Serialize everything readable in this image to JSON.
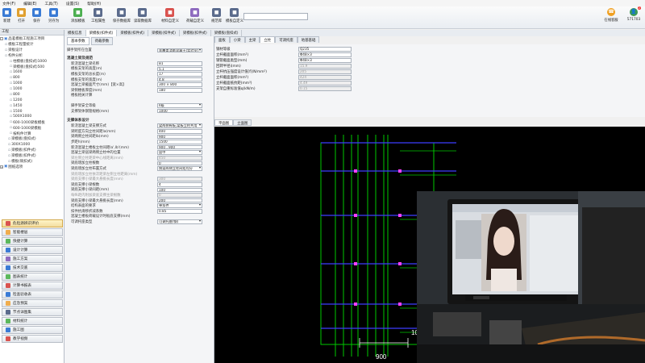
{
  "menu": [
    "文件(F)",
    "编辑(E)",
    "工具(T)",
    "设置(S)",
    "帮助(H)"
  ],
  "toolbar": [
    {
      "label": "新建",
      "icon": "new-file-icon",
      "color": "#3a7bd5"
    },
    {
      "label": "打开",
      "icon": "open-folder-icon",
      "color": "#e0a030"
    },
    {
      "label": "保存",
      "icon": "save-icon",
      "color": "#3a7bd5"
    },
    {
      "label": "另存为",
      "icon": "save-as-icon",
      "color": "#3a7bd5"
    },
    {
      "label": "添加模板",
      "icon": "add-template-icon",
      "color": "#4caf50"
    },
    {
      "label": "工程属性",
      "icon": "project-properties-icon",
      "color": "#5b6b8c"
    },
    {
      "label": "保存数据库",
      "icon": "save-db-icon",
      "color": "#5b6b8c"
    },
    {
      "label": "读取数据库",
      "icon": "read-db-icon",
      "color": "#5b6b8c"
    },
    {
      "label": "材料自定义",
      "icon": "material-custom-icon",
      "color": "#d9534f"
    },
    {
      "label": "荷载自定义",
      "icon": "load-custom-icon",
      "color": "#8e6bbf"
    },
    {
      "label": "规范库",
      "icon": "code-library-icon",
      "color": "#5b6b8c"
    },
    {
      "label": "模板自定义",
      "icon": "template-custom-icon",
      "color": "#5b6b8c"
    }
  ],
  "search": {
    "placeholder": ""
  },
  "user": {
    "label1": "在线客服",
    "label2": "571703",
    "badge": "2"
  },
  "tree": {
    "header": "工程",
    "root": "品茗模板工程施工项目",
    "items": [
      "模板工程量统计",
      "梁板设计",
      "构件分析",
      "柱模板(盘扣式)1000",
      "梁模板(盘扣式)500",
      "1600",
      "800",
      "1000",
      "1000",
      "800",
      "1200",
      "1450",
      "1500",
      "500X1000",
      "600-1000梁板模板",
      "600-1000梁模板",
      "按构件计算",
      "梁模板(盘扣式)",
      "300X1000",
      "梁模板(扣件式)",
      "梁模板(扣件式)",
      "模板(碗扣式)"
    ],
    "footer": "图纸选项"
  },
  "modules": [
    "危险源辨识评价",
    "智能楼层",
    "快捷计算",
    "设计计算",
    "施工方案",
    "技术交底",
    "图表统计",
    "计算书报表",
    "检查验收表",
    "应急预案",
    "节点详图集",
    "材料统计",
    "施工图",
    "教学视频"
  ],
  "topTabs": [
    "模板信息",
    "梁模板(扣件式)",
    "梁模板(扣件式)",
    "梁模板(扣件式)",
    "梁模板(扣件式)",
    "梁模板(盘扣式)"
  ],
  "subTabs": [
    "基本参数",
    "荷载参数"
  ],
  "form": {
    "s0_label": "脚手架所在位置",
    "s0_value": "非覆盖浇筑混凝土(实验室)",
    "s1": "混凝土梁及规范",
    "s1_rows": [
      {
        "l": "新浇混凝土梁名称",
        "v": "B1"
      },
      {
        "l": "模板支架的高度(m)",
        "v": "5.1"
      },
      {
        "l": "模板支架的总长度(m)",
        "v": "17"
      },
      {
        "l": "模板支架的宽度(m)",
        "v": "4.8"
      },
      {
        "l": "混凝土梁截面尺寸(mm)【宽×高】",
        "v": "300 × 800"
      },
      {
        "l": "梁侧楼板厚度(mm)",
        "v": "180"
      },
      {
        "l": "楼板相关计算",
        "v": ""
      }
    ],
    "s2_rows": [
      {
        "l": "脚手架安全等级",
        "v": "II级"
      },
      {
        "l": "支撑架体钢管规格(mm)",
        "v": "1000"
      }
    ],
    "s3": "支撑体系设计",
    "s3_rows": [
      {
        "l": "新浇混凝土梁支撑方式",
        "v": "梁两侧有板,梁板立柱共用"
      },
      {
        "l": "梁跨度方向立柱间距la(mm)",
        "v": "400"
      },
      {
        "l": "梁两侧立柱间距lb(mm)",
        "v": "900"
      },
      {
        "l": "步距h(mm)",
        "v": "1500"
      },
      {
        "l": "新浇混凝土楼板立柱间距la',lb'(mm)",
        "v": "900 , 900"
      },
      {
        "l": "混凝土梁居梁两侧立柱中的位置",
        "v": "居中"
      },
      {
        "l": "梁左侧立柱距梁中心线距离(mm)",
        "v": "450"
      },
      {
        "l": "梁底增加立柱根数",
        "v": "0"
      },
      {
        "l": "梁底增加立柱布置方式",
        "v": "按梁两侧立柱间距均分"
      },
      {
        "l": "梁底增加立柱依次距梁左侧立柱距离(mm)",
        "v": ""
      },
      {
        "l": "梁底支撑小梁最大悬挑长度(mm)",
        "v": "300"
      },
      {
        "l": "梁底支撑小梁根数",
        "v": "4"
      },
      {
        "l": "梁底支撑小梁间距(mm)",
        "v": "100"
      },
      {
        "l": "每纵距内附加梁底支撑主梁根数",
        "v": "0"
      },
      {
        "l": "梁底支撑小梁最大悬挑长度(mm)",
        "v": "200"
      },
      {
        "l": "结构表面的要求",
        "v": "单扣件"
      },
      {
        "l": "扣件抗滑移折减系数",
        "v": "0.85"
      },
      {
        "l": "混凝土楼板荷载设计时板底支撑(mm)",
        "v": ""
      },
      {
        "l": "可调托座类型",
        "v": "可调托座(钢)"
      }
    ]
  },
  "rightTabs": [
    "面板",
    "小梁",
    "主梁",
    "立柱",
    "可调托座",
    "地基基础"
  ],
  "rightProps": [
    {
      "l": "钢材等级",
      "v": "Q235"
    },
    {
      "l": "立杆截面面积(mm²)",
      "v": "Φ48×3"
    },
    {
      "l": "钢管截面类型(mm)",
      "v": "Φ48×3"
    },
    {
      "l": "回转半径i(mm)",
      "v": "15.9"
    },
    {
      "l": "立杆抗压强度设计值[f](N/mm²)",
      "v": "205"
    },
    {
      "l": "立杆截面面积(mm²)",
      "v": "424"
    },
    {
      "l": "立杆截面抵抗矩(mm³)",
      "v": "4.49"
    },
    {
      "l": "支架自重标准值q(kN/m)",
      "v": "0.15"
    }
  ],
  "cadTabs": [
    "平面图",
    "立面图"
  ],
  "cad": {
    "dim1": "900",
    "dim2": "10"
  },
  "colors": {
    "cadBg": "#000000",
    "cadGreen": "#00c800",
    "cadBlue": "#3c3cff",
    "cadMagenta": "#ff40ff",
    "accent": "#3a7bd5"
  }
}
